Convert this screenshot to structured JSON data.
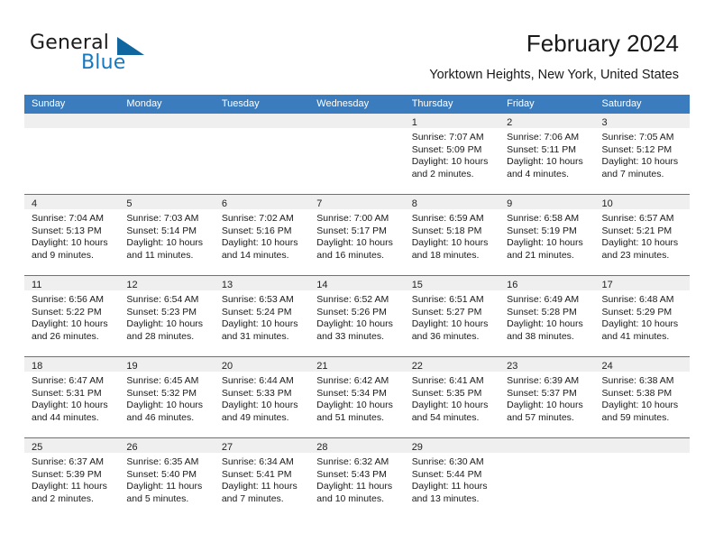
{
  "brand": {
    "line1": "General",
    "line2": "Blue",
    "accent_color": "#10669e"
  },
  "header": {
    "title": "February 2024",
    "subtitle": "Yorktown Heights, New York, United States"
  },
  "calendar": {
    "header_bg": "#3a7cbe",
    "weekdays": [
      "Sunday",
      "Monday",
      "Tuesday",
      "Wednesday",
      "Thursday",
      "Friday",
      "Saturday"
    ],
    "weeks": [
      [
        {
          "day": "",
          "sunrise": "",
          "sunset": "",
          "daylight_1": "",
          "daylight_2": ""
        },
        {
          "day": "",
          "sunrise": "",
          "sunset": "",
          "daylight_1": "",
          "daylight_2": ""
        },
        {
          "day": "",
          "sunrise": "",
          "sunset": "",
          "daylight_1": "",
          "daylight_2": ""
        },
        {
          "day": "",
          "sunrise": "",
          "sunset": "",
          "daylight_1": "",
          "daylight_2": ""
        },
        {
          "day": "1",
          "sunrise": "Sunrise: 7:07 AM",
          "sunset": "Sunset: 5:09 PM",
          "daylight_1": "Daylight: 10 hours",
          "daylight_2": "and 2 minutes."
        },
        {
          "day": "2",
          "sunrise": "Sunrise: 7:06 AM",
          "sunset": "Sunset: 5:11 PM",
          "daylight_1": "Daylight: 10 hours",
          "daylight_2": "and 4 minutes."
        },
        {
          "day": "3",
          "sunrise": "Sunrise: 7:05 AM",
          "sunset": "Sunset: 5:12 PM",
          "daylight_1": "Daylight: 10 hours",
          "daylight_2": "and 7 minutes."
        }
      ],
      [
        {
          "day": "4",
          "sunrise": "Sunrise: 7:04 AM",
          "sunset": "Sunset: 5:13 PM",
          "daylight_1": "Daylight: 10 hours",
          "daylight_2": "and 9 minutes."
        },
        {
          "day": "5",
          "sunrise": "Sunrise: 7:03 AM",
          "sunset": "Sunset: 5:14 PM",
          "daylight_1": "Daylight: 10 hours",
          "daylight_2": "and 11 minutes."
        },
        {
          "day": "6",
          "sunrise": "Sunrise: 7:02 AM",
          "sunset": "Sunset: 5:16 PM",
          "daylight_1": "Daylight: 10 hours",
          "daylight_2": "and 14 minutes."
        },
        {
          "day": "7",
          "sunrise": "Sunrise: 7:00 AM",
          "sunset": "Sunset: 5:17 PM",
          "daylight_1": "Daylight: 10 hours",
          "daylight_2": "and 16 minutes."
        },
        {
          "day": "8",
          "sunrise": "Sunrise: 6:59 AM",
          "sunset": "Sunset: 5:18 PM",
          "daylight_1": "Daylight: 10 hours",
          "daylight_2": "and 18 minutes."
        },
        {
          "day": "9",
          "sunrise": "Sunrise: 6:58 AM",
          "sunset": "Sunset: 5:19 PM",
          "daylight_1": "Daylight: 10 hours",
          "daylight_2": "and 21 minutes."
        },
        {
          "day": "10",
          "sunrise": "Sunrise: 6:57 AM",
          "sunset": "Sunset: 5:21 PM",
          "daylight_1": "Daylight: 10 hours",
          "daylight_2": "and 23 minutes."
        }
      ],
      [
        {
          "day": "11",
          "sunrise": "Sunrise: 6:56 AM",
          "sunset": "Sunset: 5:22 PM",
          "daylight_1": "Daylight: 10 hours",
          "daylight_2": "and 26 minutes."
        },
        {
          "day": "12",
          "sunrise": "Sunrise: 6:54 AM",
          "sunset": "Sunset: 5:23 PM",
          "daylight_1": "Daylight: 10 hours",
          "daylight_2": "and 28 minutes."
        },
        {
          "day": "13",
          "sunrise": "Sunrise: 6:53 AM",
          "sunset": "Sunset: 5:24 PM",
          "daylight_1": "Daylight: 10 hours",
          "daylight_2": "and 31 minutes."
        },
        {
          "day": "14",
          "sunrise": "Sunrise: 6:52 AM",
          "sunset": "Sunset: 5:26 PM",
          "daylight_1": "Daylight: 10 hours",
          "daylight_2": "and 33 minutes."
        },
        {
          "day": "15",
          "sunrise": "Sunrise: 6:51 AM",
          "sunset": "Sunset: 5:27 PM",
          "daylight_1": "Daylight: 10 hours",
          "daylight_2": "and 36 minutes."
        },
        {
          "day": "16",
          "sunrise": "Sunrise: 6:49 AM",
          "sunset": "Sunset: 5:28 PM",
          "daylight_1": "Daylight: 10 hours",
          "daylight_2": "and 38 minutes."
        },
        {
          "day": "17",
          "sunrise": "Sunrise: 6:48 AM",
          "sunset": "Sunset: 5:29 PM",
          "daylight_1": "Daylight: 10 hours",
          "daylight_2": "and 41 minutes."
        }
      ],
      [
        {
          "day": "18",
          "sunrise": "Sunrise: 6:47 AM",
          "sunset": "Sunset: 5:31 PM",
          "daylight_1": "Daylight: 10 hours",
          "daylight_2": "and 44 minutes."
        },
        {
          "day": "19",
          "sunrise": "Sunrise: 6:45 AM",
          "sunset": "Sunset: 5:32 PM",
          "daylight_1": "Daylight: 10 hours",
          "daylight_2": "and 46 minutes."
        },
        {
          "day": "20",
          "sunrise": "Sunrise: 6:44 AM",
          "sunset": "Sunset: 5:33 PM",
          "daylight_1": "Daylight: 10 hours",
          "daylight_2": "and 49 minutes."
        },
        {
          "day": "21",
          "sunrise": "Sunrise: 6:42 AM",
          "sunset": "Sunset: 5:34 PM",
          "daylight_1": "Daylight: 10 hours",
          "daylight_2": "and 51 minutes."
        },
        {
          "day": "22",
          "sunrise": "Sunrise: 6:41 AM",
          "sunset": "Sunset: 5:35 PM",
          "daylight_1": "Daylight: 10 hours",
          "daylight_2": "and 54 minutes."
        },
        {
          "day": "23",
          "sunrise": "Sunrise: 6:39 AM",
          "sunset": "Sunset: 5:37 PM",
          "daylight_1": "Daylight: 10 hours",
          "daylight_2": "and 57 minutes."
        },
        {
          "day": "24",
          "sunrise": "Sunrise: 6:38 AM",
          "sunset": "Sunset: 5:38 PM",
          "daylight_1": "Daylight: 10 hours",
          "daylight_2": "and 59 minutes."
        }
      ],
      [
        {
          "day": "25",
          "sunrise": "Sunrise: 6:37 AM",
          "sunset": "Sunset: 5:39 PM",
          "daylight_1": "Daylight: 11 hours",
          "daylight_2": "and 2 minutes."
        },
        {
          "day": "26",
          "sunrise": "Sunrise: 6:35 AM",
          "sunset": "Sunset: 5:40 PM",
          "daylight_1": "Daylight: 11 hours",
          "daylight_2": "and 5 minutes."
        },
        {
          "day": "27",
          "sunrise": "Sunrise: 6:34 AM",
          "sunset": "Sunset: 5:41 PM",
          "daylight_1": "Daylight: 11 hours",
          "daylight_2": "and 7 minutes."
        },
        {
          "day": "28",
          "sunrise": "Sunrise: 6:32 AM",
          "sunset": "Sunset: 5:43 PM",
          "daylight_1": "Daylight: 11 hours",
          "daylight_2": "and 10 minutes."
        },
        {
          "day": "29",
          "sunrise": "Sunrise: 6:30 AM",
          "sunset": "Sunset: 5:44 PM",
          "daylight_1": "Daylight: 11 hours",
          "daylight_2": "and 13 minutes."
        },
        {
          "day": "",
          "sunrise": "",
          "sunset": "",
          "daylight_1": "",
          "daylight_2": ""
        },
        {
          "day": "",
          "sunrise": "",
          "sunset": "",
          "daylight_1": "",
          "daylight_2": ""
        }
      ]
    ]
  }
}
